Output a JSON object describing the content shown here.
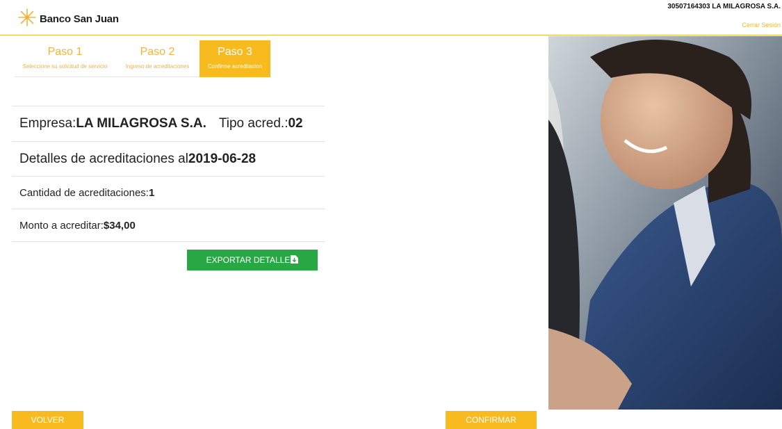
{
  "brand": {
    "name": "Banco San Juan",
    "accent": "#f8bb1f",
    "icon": "star-burst-logo-icon"
  },
  "user": {
    "label": "30507164303 LA MILAGROSA S.A.",
    "logout": "Cerrar Sesión"
  },
  "steps": [
    {
      "title": "Paso 1",
      "desc": "Seleccione su solicitud de servicio",
      "active": false
    },
    {
      "title": "Paso 2",
      "desc": "Ingreso de acreditaciones",
      "active": false
    },
    {
      "title": "Paso 3",
      "desc": "Confirme acreditacion",
      "active": true
    }
  ],
  "details": {
    "empresa_label": "Empresa: ",
    "empresa_value": "LA MILAGROSA S.A.",
    "tipo_label": "Tipo acred.: ",
    "tipo_value": "02",
    "fecha_label": "Detalles de acreditaciones al ",
    "fecha_value": "2019-06-28",
    "cantidad_label": "Cantidad de acreditaciones: ",
    "cantidad_value": "1",
    "monto_label": "Monto a acreditar: ",
    "monto_value": "$34,00"
  },
  "actions": {
    "export_label": "EXPORTAR DETALLE",
    "export_icon": "file-download-icon",
    "back_label": "VOLVER",
    "confirm_label": "CONFIRMAR"
  },
  "colors": {
    "accent": "#f8bb1f",
    "success": "#28a745",
    "text": "#222222"
  }
}
